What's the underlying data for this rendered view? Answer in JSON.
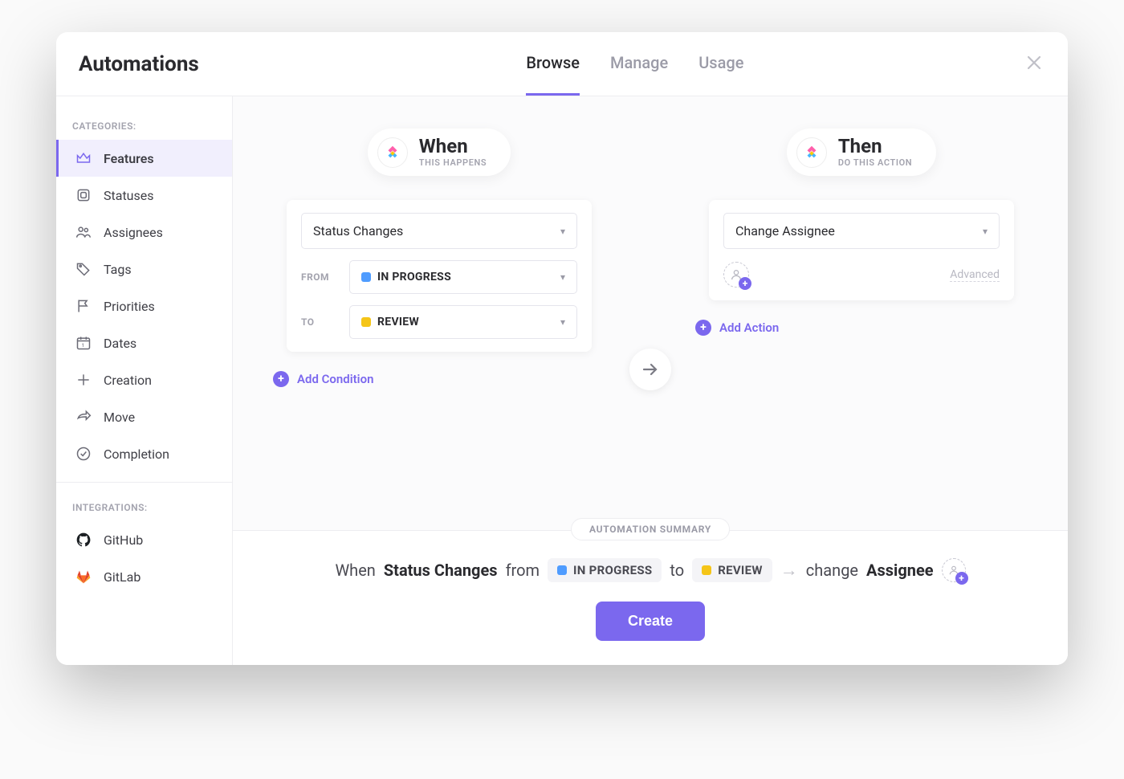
{
  "header": {
    "title": "Automations",
    "tabs": [
      "Browse",
      "Manage",
      "Usage"
    ],
    "active_tab": "Browse"
  },
  "sidebar": {
    "categories_label": "CATEGORIES:",
    "integrations_label": "INTEGRATIONS:",
    "categories": [
      {
        "id": "features",
        "label": "Features",
        "icon": "crown",
        "active": true
      },
      {
        "id": "statuses",
        "label": "Statuses",
        "icon": "square"
      },
      {
        "id": "assignees",
        "label": "Assignees",
        "icon": "people"
      },
      {
        "id": "tags",
        "label": "Tags",
        "icon": "tag"
      },
      {
        "id": "priorities",
        "label": "Priorities",
        "icon": "flag"
      },
      {
        "id": "dates",
        "label": "Dates",
        "icon": "calendar"
      },
      {
        "id": "creation",
        "label": "Creation",
        "icon": "plus"
      },
      {
        "id": "move",
        "label": "Move",
        "icon": "share"
      },
      {
        "id": "completion",
        "label": "Completion",
        "icon": "check"
      }
    ],
    "integrations": [
      {
        "id": "github",
        "label": "GitHub",
        "icon": "github"
      },
      {
        "id": "gitlab",
        "label": "GitLab",
        "icon": "gitlab"
      }
    ]
  },
  "when": {
    "title": "When",
    "subtitle": "THIS HAPPENS",
    "trigger": "Status Changes",
    "from_label": "FROM",
    "to_label": "TO",
    "from_status": {
      "name": "IN PROGRESS",
      "color": "#4f9cff"
    },
    "to_status": {
      "name": "REVIEW",
      "color": "#f5c518"
    },
    "add_condition": "Add Condition"
  },
  "then": {
    "title": "Then",
    "subtitle": "DO THIS ACTION",
    "action": "Change Assignee",
    "advanced": "Advanced",
    "add_action": "Add Action"
  },
  "summary": {
    "label": "AUTOMATION SUMMARY",
    "when_word": "When",
    "trigger": "Status Changes",
    "from_word": "from",
    "from_status": {
      "name": "IN PROGRESS",
      "color": "#4f9cff"
    },
    "to_word": "to",
    "to_status": {
      "name": "REVIEW",
      "color": "#f5c518"
    },
    "change_word": "change",
    "target": "Assignee",
    "create_button": "Create"
  }
}
